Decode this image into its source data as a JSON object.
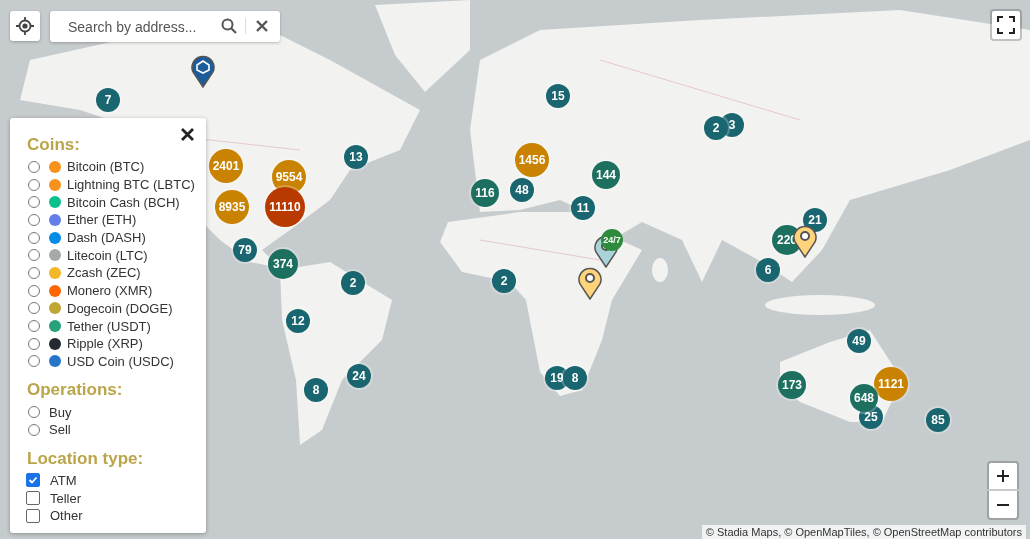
{
  "search": {
    "placeholder": "Search by address..."
  },
  "filters": {
    "coins_title": "Coins:",
    "coins": [
      {
        "label": "Bitcoin (BTC)",
        "color": "#f7931a",
        "selected": false
      },
      {
        "label": "Lightning BTC (LBTC)",
        "color": "#f7931a",
        "selected": false
      },
      {
        "label": "Bitcoin Cash (BCH)",
        "color": "#0ac18e",
        "selected": false
      },
      {
        "label": "Ether (ETH)",
        "color": "#627eea",
        "selected": false
      },
      {
        "label": "Dash (DASH)",
        "color": "#008ce7",
        "selected": false
      },
      {
        "label": "Litecoin (LTC)",
        "color": "#a6a9aa",
        "selected": false
      },
      {
        "label": "Zcash (ZEC)",
        "color": "#f4b728",
        "selected": false
      },
      {
        "label": "Monero (XMR)",
        "color": "#ff6600",
        "selected": false
      },
      {
        "label": "Dogecoin (DOGE)",
        "color": "#c2a633",
        "selected": false
      },
      {
        "label": "Tether (USDT)",
        "color": "#26a17b",
        "selected": false
      },
      {
        "label": "Ripple (XRP)",
        "color": "#23292f",
        "selected": false
      },
      {
        "label": "USD Coin (USDC)",
        "color": "#2775ca",
        "selected": false
      }
    ],
    "operations_title": "Operations:",
    "operations": [
      {
        "label": "Buy",
        "selected": false
      },
      {
        "label": "Sell",
        "selected": false
      }
    ],
    "location_title": "Location type:",
    "location_types": [
      {
        "label": "ATM",
        "checked": true
      },
      {
        "label": "Teller",
        "checked": false
      },
      {
        "label": "Other",
        "checked": false
      }
    ]
  },
  "clusters": [
    {
      "count": "7",
      "color": "#1a6670"
    },
    {
      "count": "2401",
      "color": "#c98300"
    },
    {
      "count": "9554",
      "color": "#c98300"
    },
    {
      "count": "8935",
      "color": "#c98300"
    },
    {
      "count": "11110",
      "color": "#b83a00"
    },
    {
      "count": "13",
      "color": "#1a6670"
    },
    {
      "count": "79",
      "color": "#1a6670"
    },
    {
      "count": "374",
      "color": "#1d7060"
    },
    {
      "count": "2",
      "color": "#1a6670"
    },
    {
      "count": "12",
      "color": "#1a6670"
    },
    {
      "count": "24",
      "color": "#1a6670"
    },
    {
      "count": "8",
      "color": "#1a6670"
    },
    {
      "count": "116",
      "color": "#1d7060"
    },
    {
      "count": "48",
      "color": "#1a6670"
    },
    {
      "count": "1456",
      "color": "#c98300"
    },
    {
      "count": "15",
      "color": "#1a6670"
    },
    {
      "count": "144",
      "color": "#1d7060"
    },
    {
      "count": "11",
      "color": "#1a6670"
    },
    {
      "count": "2",
      "color": "#1a6670"
    },
    {
      "count": "3",
      "color": "#1a6670"
    },
    {
      "count": "2",
      "color": "#1a6670"
    },
    {
      "count": "21",
      "color": "#1a6670"
    },
    {
      "count": "220",
      "color": "#1d7060"
    },
    {
      "count": "6",
      "color": "#1a6670"
    },
    {
      "count": "49",
      "color": "#1a6670"
    },
    {
      "count": "173",
      "color": "#1d7060"
    },
    {
      "count": "1121",
      "color": "#c98300"
    },
    {
      "count": "19",
      "color": "#1a6670"
    },
    {
      "count": "8",
      "color": "#1a6670"
    },
    {
      "count": "648",
      "color": "#1d7060"
    },
    {
      "count": "25",
      "color": "#1a6670"
    },
    {
      "count": "85",
      "color": "#1a6670"
    }
  ],
  "pins": [
    {
      "kind": "operator",
      "color": "#1d5c9a"
    },
    {
      "kind": "plain",
      "color": "#a9d3d6"
    },
    {
      "kind": "plain",
      "color": "#ffd37a"
    },
    {
      "kind": "plain",
      "color": "#ffd37a"
    }
  ],
  "badges": [
    {
      "label": "24/7"
    }
  ],
  "attribution": "© Stadia Maps, © OpenMapTiles, © OpenStreetMap contributors"
}
